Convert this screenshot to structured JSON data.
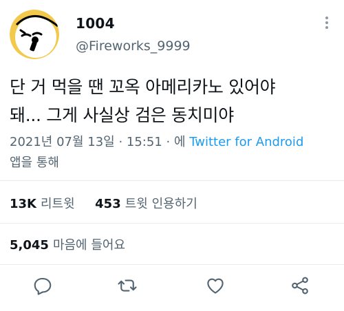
{
  "user": {
    "display_name": "1004",
    "handle": "@Fireworks_9999",
    "avatar_icon": "cartoon-face-microphone-avatar"
  },
  "tweet": {
    "text": "단 거 먹을 땐 꼬옥 아메리카노 있어야\n돼... 그게 사실상 검은 동치미야",
    "timestamp": "2021년 07월 13일 · 15:51 · 에",
    "source": "Twitter for Android",
    "source_suffix": "앱을 통해"
  },
  "stats": {
    "retweets_count": "13K",
    "retweets_label": "리트윗",
    "quotes_count": "453",
    "quotes_label": "트윗 인용하기",
    "likes_count": "5,045",
    "likes_label": "마음에 들어요"
  },
  "actions": [
    "reply-icon",
    "retweet-icon",
    "like-icon",
    "share-icon"
  ],
  "colors": {
    "link": "#1d9bf0",
    "secondary_text": "#536471",
    "icon": "#536471",
    "avatar_ring": "#f2c94c"
  }
}
